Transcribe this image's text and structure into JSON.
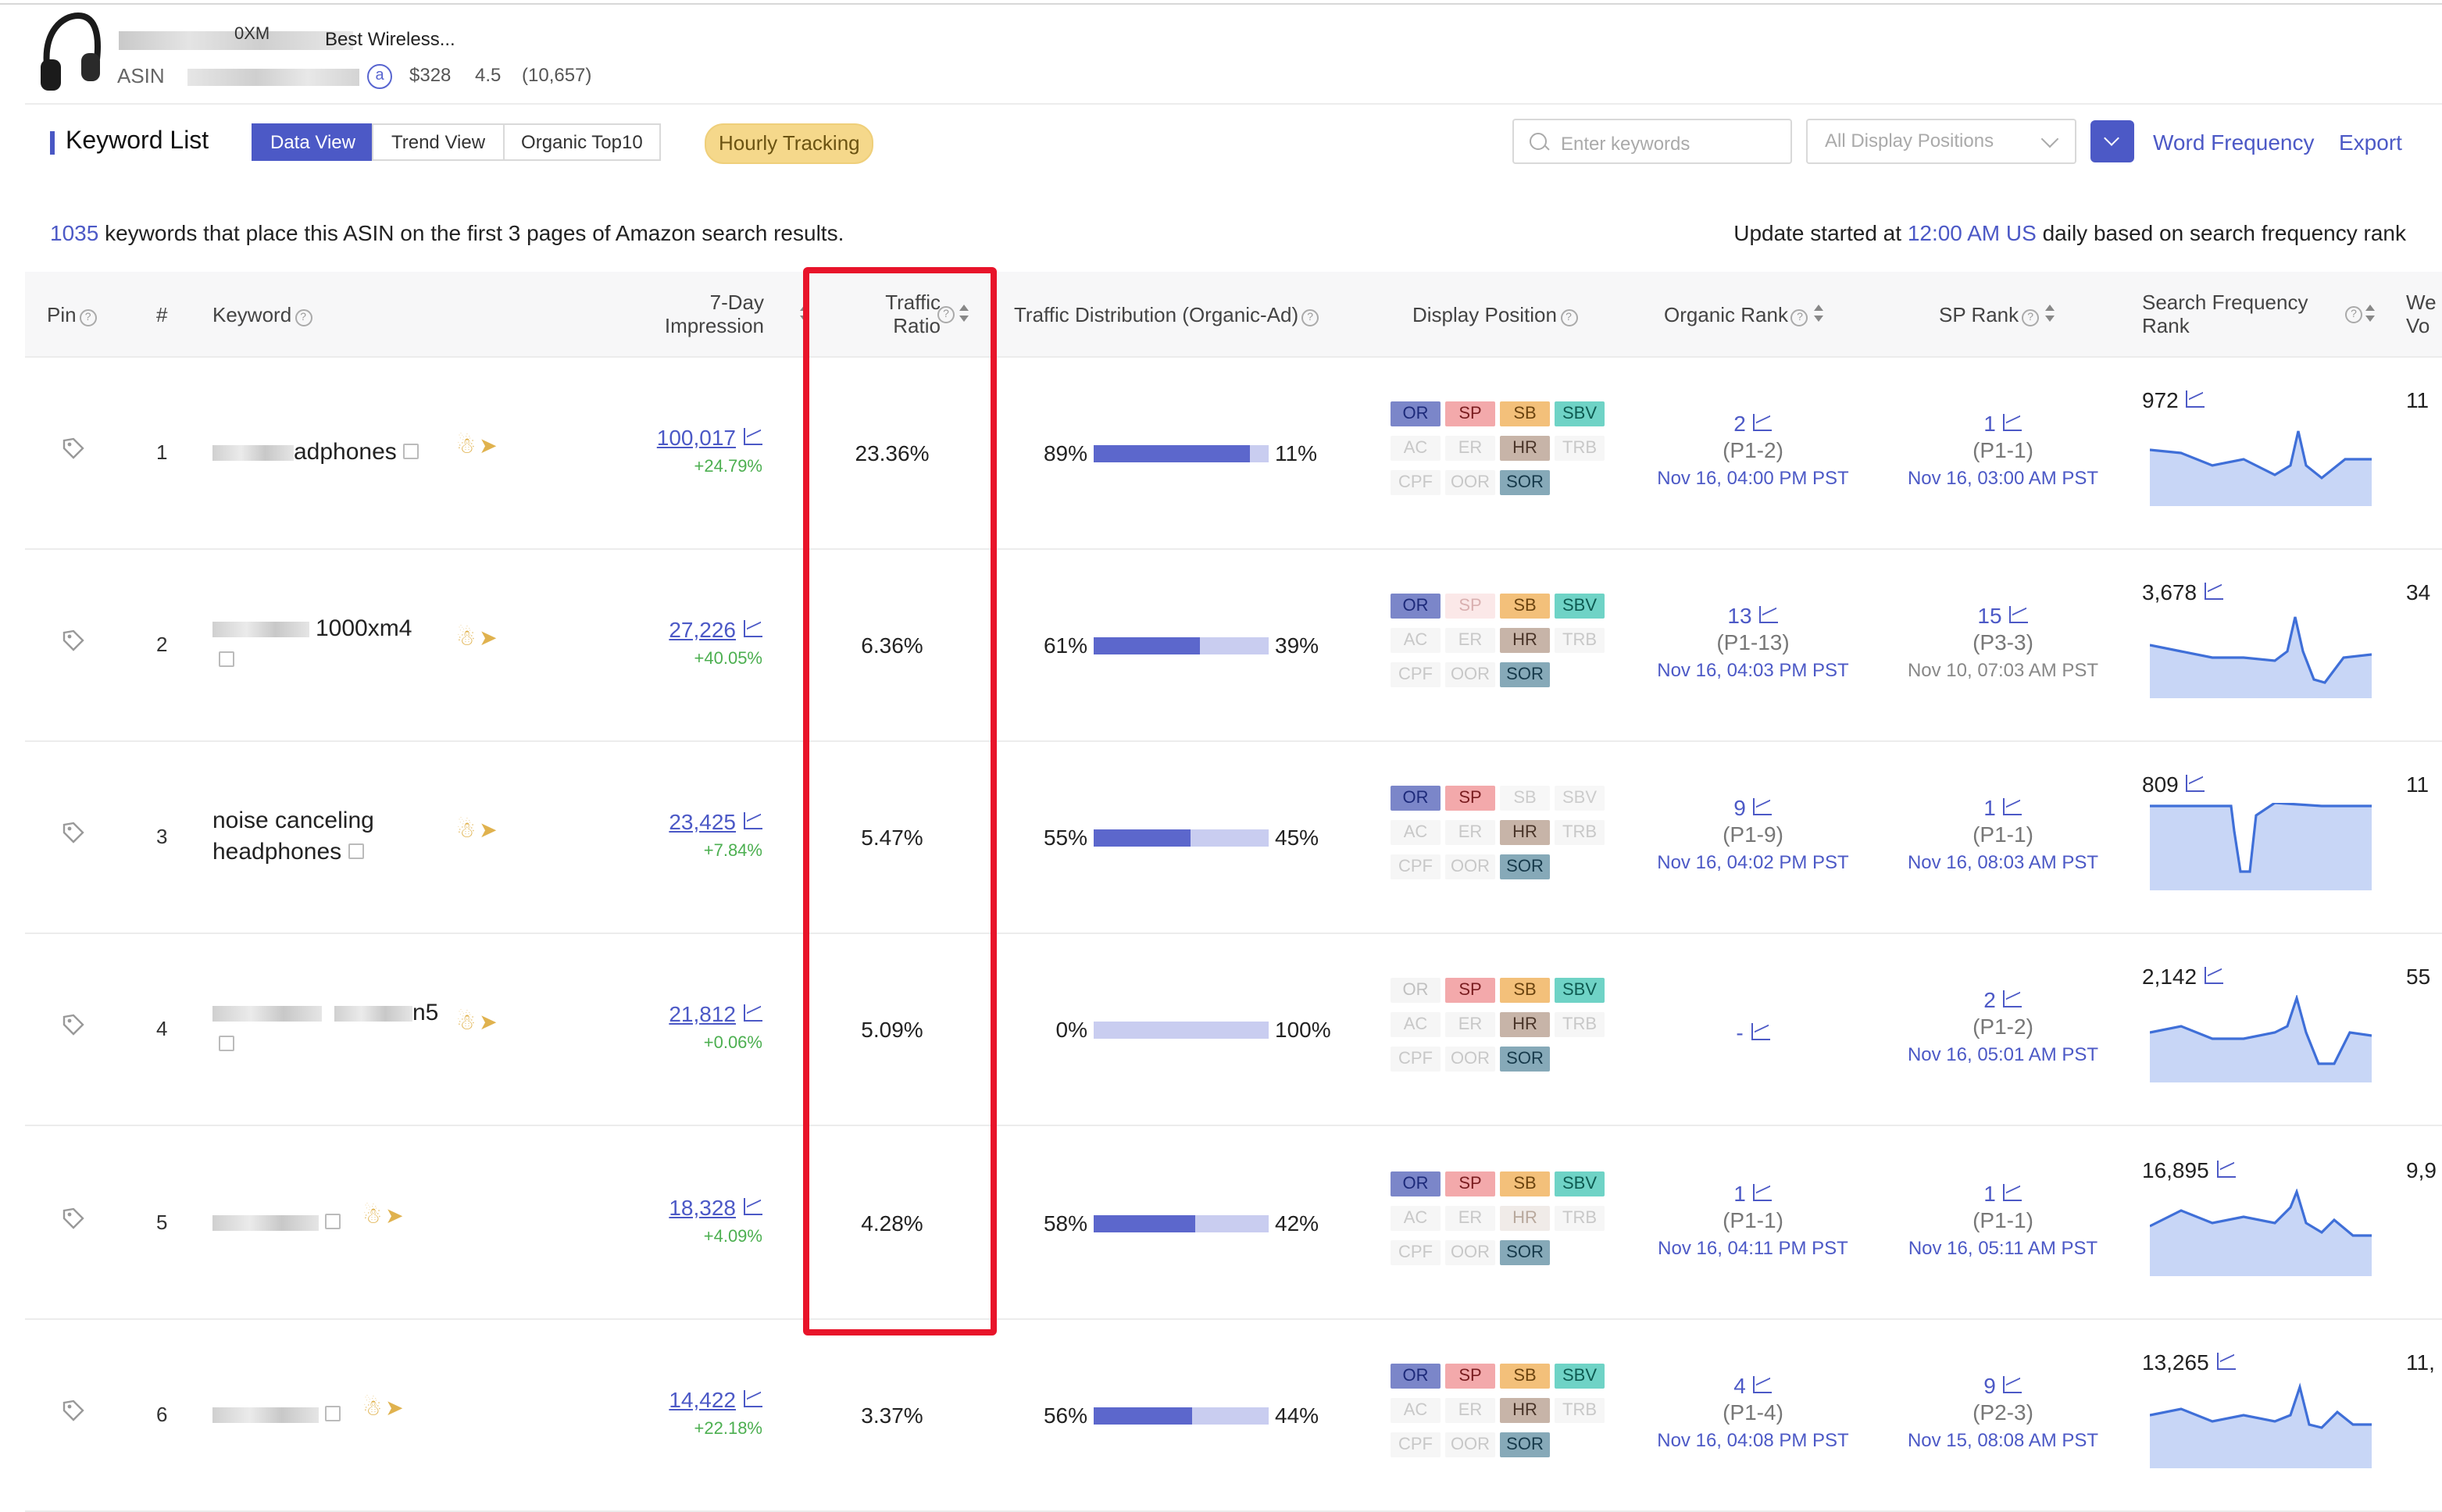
{
  "product": {
    "title_visible": "Best Wireless...",
    "title_fragment": "0XM",
    "asin_label": "ASIN",
    "price": "$328",
    "rating": "4.5",
    "reviews": "(10,657)"
  },
  "toolbar": {
    "title": "Keyword List",
    "tabs": [
      "Data View",
      "Trend View",
      "Organic Top10"
    ],
    "hourly": "Hourly Tracking",
    "search_placeholder": "Enter keywords",
    "positions_placeholder": "All Display Positions",
    "word_frequency": "Word Frequency",
    "export": "Export"
  },
  "info": {
    "count": "1035",
    "left_text": " keywords that place this ASIN on the first 3 pages of Amazon search results.",
    "right_prefix": "Update started at ",
    "right_time": "12:00 AM US",
    "right_suffix": " daily based on search frequency rank"
  },
  "columns": {
    "pin": "Pin",
    "index": "#",
    "keyword": "Keyword",
    "impression_1": "7-Day",
    "impression_2": "Impression",
    "ratio_1": "Traffic",
    "ratio_2": "Ratio",
    "distribution": "Traffic Distribution (Organic-Ad)",
    "display_position": "Display Position",
    "organic_rank": "Organic Rank",
    "sp_rank": "SP Rank",
    "freq_1": "Search Frequency",
    "freq_2": "Rank",
    "weekly_1": "We",
    "weekly_2": "Vo"
  },
  "colors": {
    "accent": "#4c59c6",
    "highlight": "#e8142a",
    "positive": "#4caf50"
  },
  "rows": [
    {
      "index": "1",
      "keyword": "adphones",
      "impression": "100,017",
      "delta": "+24.79%",
      "ratio": "23.36%",
      "organic_pct": "89%",
      "ad_pct": "11%",
      "organic_share": 89,
      "organic_rank": "2",
      "organic_page": "(P1-2)",
      "organic_ts": "Nov 16, 04:00 PM PST",
      "sp_rank": "1",
      "sp_page": "(P1-1)",
      "sp_ts": "Nov 16, 03:00 AM PST",
      "freq": "972",
      "weekly": "11"
    },
    {
      "index": "2",
      "keyword": "1000xm4",
      "impression": "27,226",
      "delta": "+40.05%",
      "ratio": "6.36%",
      "organic_pct": "61%",
      "ad_pct": "39%",
      "organic_share": 61,
      "organic_rank": "13",
      "organic_page": "(P1-13)",
      "organic_ts": "Nov 16, 04:03 PM PST",
      "sp_rank": "15",
      "sp_page": "(P3-3)",
      "sp_ts": "Nov 10, 07:03 AM PST",
      "freq": "3,678",
      "weekly": "34"
    },
    {
      "index": "3",
      "keyword_line1": "noise canceling",
      "keyword_line2": "headphones",
      "impression": "23,425",
      "delta": "+7.84%",
      "ratio": "5.47%",
      "organic_pct": "55%",
      "ad_pct": "45%",
      "organic_share": 55,
      "organic_rank": "9",
      "organic_page": "(P1-9)",
      "organic_ts": "Nov 16, 04:02 PM PST",
      "sp_rank": "1",
      "sp_page": "(P1-1)",
      "sp_ts": "Nov 16, 08:03 AM PST",
      "freq": "809",
      "weekly": "11"
    },
    {
      "index": "4",
      "keyword": "n5",
      "impression": "21,812",
      "delta": "+0.06%",
      "ratio": "5.09%",
      "organic_pct": "0%",
      "ad_pct": "100%",
      "organic_share": 0,
      "organic_rank": "-",
      "organic_page": "",
      "organic_ts": "",
      "sp_rank": "2",
      "sp_page": "(P1-2)",
      "sp_ts": "Nov 16, 05:01 AM PST",
      "freq": "2,142",
      "weekly": "55"
    },
    {
      "index": "5",
      "keyword": "",
      "impression": "18,328",
      "delta": "+4.09%",
      "ratio": "4.28%",
      "organic_pct": "58%",
      "ad_pct": "42%",
      "organic_share": 58,
      "organic_rank": "1",
      "organic_page": "(P1-1)",
      "organic_ts": "Nov 16, 04:11 PM PST",
      "sp_rank": "1",
      "sp_page": "(P1-1)",
      "sp_ts": "Nov 16, 05:11 AM PST",
      "freq": "16,895",
      "weekly": "9,9"
    },
    {
      "index": "6",
      "keyword": "",
      "impression": "14,422",
      "delta": "+22.18%",
      "ratio": "3.37%",
      "organic_pct": "56%",
      "ad_pct": "44%",
      "organic_share": 56,
      "organic_rank": "4",
      "organic_page": "(P1-4)",
      "organic_ts": "Nov 16, 04:08 PM PST",
      "sp_rank": "9",
      "sp_page": "(P2-3)",
      "sp_ts": "Nov 15, 08:08 AM PST",
      "freq": "13,265",
      "weekly": "11,"
    }
  ],
  "tag_labels": [
    "OR",
    "SP",
    "SB",
    "SBV",
    "AC",
    "ER",
    "HR",
    "TRB",
    "CPF",
    "OOR",
    "SOR"
  ],
  "row_tags_active": [
    [
      "OR",
      "SP",
      "SB",
      "SBV",
      "HR",
      "SOR"
    ],
    [
      "OR",
      "SB",
      "SBV",
      "HR",
      "SOR"
    ],
    [
      "OR",
      "SP",
      "HR",
      "SOR"
    ],
    [
      "SP",
      "SB",
      "SBV",
      "HR",
      "SOR"
    ],
    [
      "OR",
      "SP",
      "SB",
      "SBV",
      "SOR"
    ],
    [
      "OR",
      "SP",
      "SB",
      "SBV",
      "HR",
      "SOR"
    ]
  ]
}
